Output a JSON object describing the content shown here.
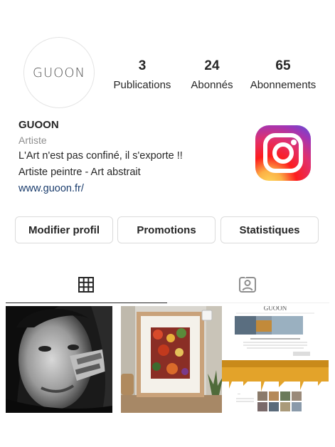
{
  "profile": {
    "avatar_text": "GUOON",
    "stats": [
      {
        "value": "3",
        "label": "Publications"
      },
      {
        "value": "24",
        "label": "Abonnés"
      },
      {
        "value": "65",
        "label": "Abonnements"
      }
    ],
    "name": "GUOON",
    "category": "Artiste",
    "bio_line1": "L'Art n'est pas confiné, il s'exporte !!",
    "bio_line2": "Artiste peintre - Art abstrait",
    "website": "www.guoon.fr/"
  },
  "actions": {
    "edit_profile": "Modifier profil",
    "promotions": "Promotions",
    "statistics": "Statistiques"
  },
  "tabs": {
    "grid": "grid-icon",
    "tagged": "tagged-icon"
  },
  "posts": [
    {
      "name": "post-portrait"
    },
    {
      "name": "post-framed-painting"
    },
    {
      "name": "post-website-screenshot",
      "header_text": "GUOON"
    }
  ],
  "colors": {
    "text": "#262626",
    "secondary": "#8e8e8e",
    "link": "#1b3d6d",
    "border": "#dbdbdb"
  }
}
